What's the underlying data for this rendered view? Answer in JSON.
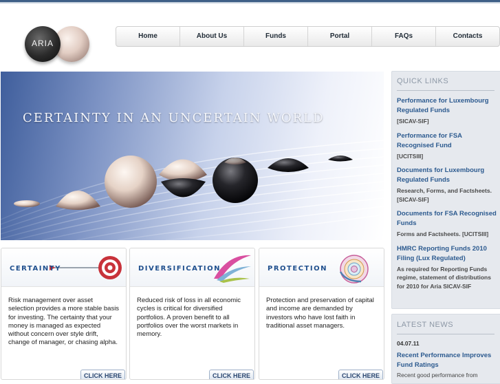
{
  "logo": {
    "wordmark": "ARIA"
  },
  "nav": {
    "items": [
      {
        "label": "Home"
      },
      {
        "label": "About Us"
      },
      {
        "label": "Funds"
      },
      {
        "label": "Portal"
      },
      {
        "label": "FAQs"
      },
      {
        "label": "Contacts"
      }
    ]
  },
  "banner": {
    "headline": "Certainty in an uncertain world"
  },
  "cards": [
    {
      "title": "CERTAINTY",
      "text": "Risk management over asset selection provides a more stable basis for investing. The certainty that your money is managed as expected without concern over style drift, change of manager, or chasing alpha.",
      "button": "CLICK HERE"
    },
    {
      "title": "DIVERSIFICATION",
      "text": "Reduced risk of loss in all economic cycles is critical for diversified portfolios. A proven benefit to all portfolios over the worst markets in memory.",
      "button": "CLICK HERE"
    },
    {
      "title": "PROTECTION",
      "text": "Protection and preservation of capital and income are demanded by investors who have lost faith in traditional asset managers.",
      "button": "CLICK HERE"
    }
  ],
  "quick_links": {
    "title": "QUICK LINKS",
    "items": [
      {
        "link": "Performance for Luxembourg Regulated Funds",
        "desc": "[SICAV-SIF]"
      },
      {
        "link": "Performance for FSA Recognised Fund",
        "desc": "[UCITSIII]"
      },
      {
        "link": "Documents for Luxembourg Regulated Funds",
        "desc": "Research, Forms, and Factsheets. [SICAV-SIF]"
      },
      {
        "link": "Documents for FSA Recognised Funds",
        "desc": "Forms and Factsheets. [UCITSIII]"
      },
      {
        "link": "HMRC Reporting Funds 2010 Filing (Lux Regulated)",
        "desc": "As required for Reporting Funds regime, statement of distributions for 2010 for Aria SICAV-SIF"
      }
    ]
  },
  "latest_news": {
    "title": "LATEST NEWS",
    "date": "04.07.11",
    "headline": "Recent Performance Improves Fund Ratings",
    "snippet": "Recent good performance from"
  }
}
